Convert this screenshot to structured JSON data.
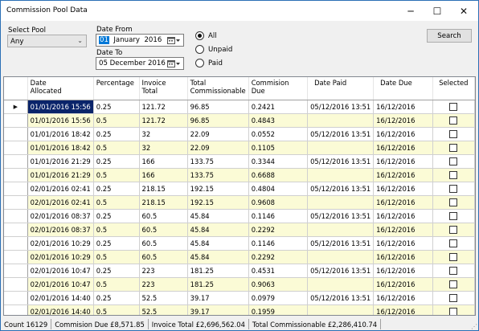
{
  "window": {
    "title": "Commission Pool Data",
    "minimize_glyph": "─",
    "maximize_glyph": "☐",
    "close_glyph": "✕"
  },
  "filters": {
    "select_pool_label": "Select Pool",
    "pool_value": "Any",
    "date_from_label": "Date From",
    "date_from_value": "01  January  2016",
    "date_from_day": "01",
    "date_from_rest": "  January  2016",
    "date_to_label": "Date To",
    "date_to_value": "05 December 2016",
    "status_options": [
      {
        "label": "All",
        "selected": true
      },
      {
        "label": "Unpaid",
        "selected": false
      },
      {
        "label": "Paid",
        "selected": false
      }
    ],
    "search_label": "Search"
  },
  "grid": {
    "columns": [
      "Date Allocated",
      "Percentage",
      "Invoice Total",
      "Total Commissionable",
      "Commision Due",
      "Date Paid",
      "Date Due",
      "Selected"
    ],
    "column_lines": [
      [
        "Date",
        "Allocated"
      ],
      [
        "Percentage"
      ],
      [
        "Invoice",
        "Total"
      ],
      [
        "Total",
        "Commissionable"
      ],
      [
        "Commision",
        "Due"
      ],
      [
        "Date Paid"
      ],
      [
        "Date Due"
      ],
      [
        "Selected"
      ]
    ],
    "current_row_marker": "▶",
    "rows": [
      {
        "date_allocated": "01/01/2016 15:56",
        "percentage": "0.25",
        "invoice_total": "121.72",
        "total_commissionable": "96.85",
        "commission_due": "0.2421",
        "date_paid": "05/12/2016 13:51",
        "date_due": "16/12/2016",
        "selected": false
      },
      {
        "date_allocated": "01/01/2016 15:56",
        "percentage": "0.5",
        "invoice_total": "121.72",
        "total_commissionable": "96.85",
        "commission_due": "0.4843",
        "date_paid": "",
        "date_due": "16/12/2016",
        "selected": false
      },
      {
        "date_allocated": "01/01/2016 18:42",
        "percentage": "0.25",
        "invoice_total": "32",
        "total_commissionable": "22.09",
        "commission_due": "0.0552",
        "date_paid": "05/12/2016 13:51",
        "date_due": "16/12/2016",
        "selected": false
      },
      {
        "date_allocated": "01/01/2016 18:42",
        "percentage": "0.5",
        "invoice_total": "32",
        "total_commissionable": "22.09",
        "commission_due": "0.1105",
        "date_paid": "",
        "date_due": "16/12/2016",
        "selected": false
      },
      {
        "date_allocated": "01/01/2016 21:29",
        "percentage": "0.25",
        "invoice_total": "166",
        "total_commissionable": "133.75",
        "commission_due": "0.3344",
        "date_paid": "05/12/2016 13:51",
        "date_due": "16/12/2016",
        "selected": false
      },
      {
        "date_allocated": "01/01/2016 21:29",
        "percentage": "0.5",
        "invoice_total": "166",
        "total_commissionable": "133.75",
        "commission_due": "0.6688",
        "date_paid": "",
        "date_due": "16/12/2016",
        "selected": false
      },
      {
        "date_allocated": "02/01/2016 02:41",
        "percentage": "0.25",
        "invoice_total": "218.15",
        "total_commissionable": "192.15",
        "commission_due": "0.4804",
        "date_paid": "05/12/2016 13:51",
        "date_due": "16/12/2016",
        "selected": false
      },
      {
        "date_allocated": "02/01/2016 02:41",
        "percentage": "0.5",
        "invoice_total": "218.15",
        "total_commissionable": "192.15",
        "commission_due": "0.9608",
        "date_paid": "",
        "date_due": "16/12/2016",
        "selected": false
      },
      {
        "date_allocated": "02/01/2016 08:37",
        "percentage": "0.25",
        "invoice_total": "60.5",
        "total_commissionable": "45.84",
        "commission_due": "0.1146",
        "date_paid": "05/12/2016 13:51",
        "date_due": "16/12/2016",
        "selected": false
      },
      {
        "date_allocated": "02/01/2016 08:37",
        "percentage": "0.5",
        "invoice_total": "60.5",
        "total_commissionable": "45.84",
        "commission_due": "0.2292",
        "date_paid": "",
        "date_due": "16/12/2016",
        "selected": false
      },
      {
        "date_allocated": "02/01/2016 10:29",
        "percentage": "0.25",
        "invoice_total": "60.5",
        "total_commissionable": "45.84",
        "commission_due": "0.1146",
        "date_paid": "05/12/2016 13:51",
        "date_due": "16/12/2016",
        "selected": false
      },
      {
        "date_allocated": "02/01/2016 10:29",
        "percentage": "0.5",
        "invoice_total": "60.5",
        "total_commissionable": "45.84",
        "commission_due": "0.2292",
        "date_paid": "",
        "date_due": "16/12/2016",
        "selected": false
      },
      {
        "date_allocated": "02/01/2016 10:47",
        "percentage": "0.25",
        "invoice_total": "223",
        "total_commissionable": "181.25",
        "commission_due": "0.4531",
        "date_paid": "05/12/2016 13:51",
        "date_due": "16/12/2016",
        "selected": false
      },
      {
        "date_allocated": "02/01/2016 10:47",
        "percentage": "0.5",
        "invoice_total": "223",
        "total_commissionable": "181.25",
        "commission_due": "0.9063",
        "date_paid": "",
        "date_due": "16/12/2016",
        "selected": false
      },
      {
        "date_allocated": "02/01/2016 14:40",
        "percentage": "0.25",
        "invoice_total": "52.5",
        "total_commissionable": "39.17",
        "commission_due": "0.0979",
        "date_paid": "05/12/2016 13:51",
        "date_due": "16/12/2016",
        "selected": false
      },
      {
        "date_allocated": "02/01/2016 14:40",
        "percentage": "0.5",
        "invoice_total": "52.5",
        "total_commissionable": "39.17",
        "commission_due": "0.1959",
        "date_paid": "",
        "date_due": "16/12/2016",
        "selected": false
      }
    ]
  },
  "status_bar": {
    "count": "Count 16129",
    "commission_due": "Commision Due £8,571.85",
    "invoice_total": "Invoice Total £2,696,562.04",
    "total_commissionable": "Total Commissionable £2,286,410.74"
  }
}
